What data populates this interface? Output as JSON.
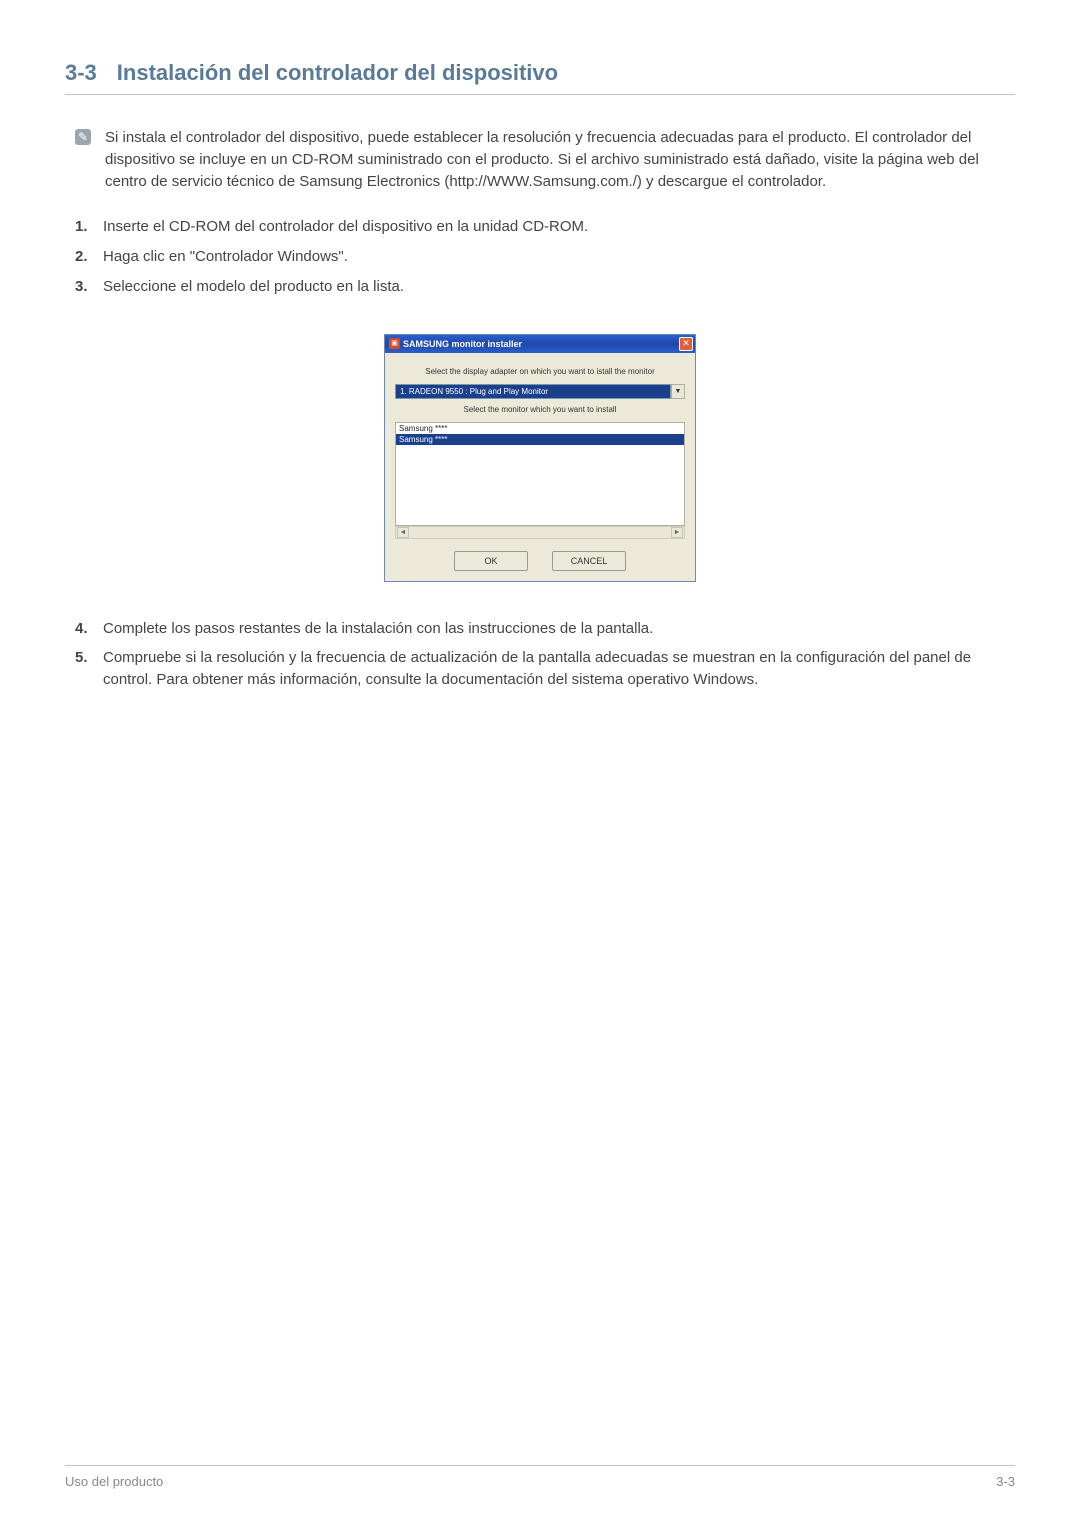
{
  "heading": {
    "number": "3-3",
    "title": "Instalación del controlador del dispositivo"
  },
  "note": "Si instala el controlador del dispositivo, puede establecer la resolución y frecuencia adecuadas para el producto. El controlador del dispositivo se incluye en un CD-ROM suministrado con el producto. Si el archivo suministrado está dañado, visite la página web del centro de servicio técnico de Samsung Electronics (http://WWW.Samsung.com./) y descargue el controlador.",
  "steps": {
    "s1": "Inserte el CD-ROM del controlador del dispositivo en la unidad CD-ROM.",
    "s2": "Haga clic en \"Controlador Windows\".",
    "s3": "Seleccione el modelo del producto en la lista.",
    "s4": "Complete los pasos restantes de la instalación con las instrucciones de la pantalla.",
    "s5": "Compruebe si la resolución y la frecuencia de actualización de la pantalla adecuadas se muestran en la configuración del panel de control. Para obtener más información, consulte la documentación del sistema operativo Windows."
  },
  "installer": {
    "title": "SAMSUNG monitor installer",
    "label_adapter": "Select the display adapter on which you want to istall the monitor",
    "adapter_value": "1. RADEON 9550 : Plug and Play Monitor",
    "label_monitor": "Select the monitor which you want to install",
    "list_item1": "Samsung ****",
    "list_item2": "Samsung ****",
    "ok": "OK",
    "cancel": "CANCEL"
  },
  "footer": {
    "left": "Uso del producto",
    "right": "3-3"
  }
}
